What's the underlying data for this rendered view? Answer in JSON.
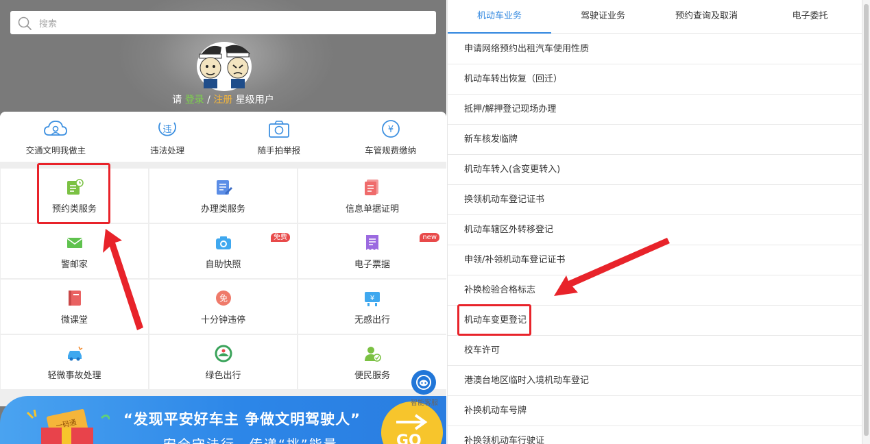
{
  "search": {
    "placeholder": "搜索"
  },
  "login": {
    "prefix": "请 ",
    "login": "登录",
    "sep": " / ",
    "register": "注册",
    "suffix": " 星级用户"
  },
  "quick": [
    {
      "label": "交通文明我做主",
      "icon": "cloud-user-icon"
    },
    {
      "label": "违法处理",
      "icon": "violation-icon"
    },
    {
      "label": "随手拍举报",
      "icon": "camera-icon"
    },
    {
      "label": "车管规费缴纳",
      "icon": "yuan-coin-icon"
    }
  ],
  "services": [
    {
      "label": "预约类服务",
      "icon": "appointment-icon",
      "color": "#7bc143"
    },
    {
      "label": "办理类服务",
      "icon": "document-edit-icon",
      "color": "#5b8de6"
    },
    {
      "label": "信息单据证明",
      "icon": "certificate-icon",
      "color": "#ef6b6b"
    },
    {
      "label": "警邮家",
      "icon": "mail-icon",
      "color": "#5fc24e"
    },
    {
      "label": "自助快照",
      "icon": "photo-icon",
      "color": "#3fa8ef",
      "badge": "免费"
    },
    {
      "label": "电子票据",
      "icon": "receipt-icon",
      "color": "#9b6ae0",
      "badge": "new"
    },
    {
      "label": "微课堂",
      "icon": "book-icon",
      "color": "#e96262"
    },
    {
      "label": "十分钟违停",
      "icon": "parking-exempt-icon",
      "color": "#ef7a6a"
    },
    {
      "label": "无感出行",
      "icon": "toll-icon",
      "color": "#3fa8ef"
    },
    {
      "label": "轻微事故处理",
      "icon": "car-accident-icon",
      "color": "#3fa8ef"
    },
    {
      "label": "绿色出行",
      "icon": "green-travel-icon",
      "color": "#3aa35a"
    },
    {
      "label": "便民服务",
      "icon": "person-service-icon",
      "color": "#7bc143"
    }
  ],
  "assistant": {
    "label": "智能客服",
    "icon": "headset-icon"
  },
  "banner": {
    "line1": "“发现平安好车主 争做文明驾驶人”",
    "line2": "安全守法行，传递“挑”能量",
    "go": "GO",
    "ticket": "一码通"
  },
  "tabs": [
    {
      "label": "机动车业务",
      "active": true
    },
    {
      "label": "驾驶证业务",
      "active": false
    },
    {
      "label": "预约查询及取消",
      "active": false
    },
    {
      "label": "电子委托",
      "active": false
    }
  ],
  "list": [
    "申请网络预约出租汽车使用性质",
    "机动车转出恢复（回迁）",
    "抵押/解押登记现场办理",
    "新车核发临牌",
    "机动车转入(含变更转入)",
    "换领机动车登记证书",
    "机动车辖区外转移登记",
    "申领/补领机动车登记证书",
    "补换检验合格标志",
    "机动车变更登记",
    "校车许可",
    "港澳台地区临时入境机动车登记",
    "补换机动车号牌",
    "补换领机动车行驶证"
  ],
  "colors": {
    "accent": "#2f86df",
    "highlight": "#e8232a",
    "login_green": "#7dd44b",
    "register_orange": "#f4b63c"
  }
}
